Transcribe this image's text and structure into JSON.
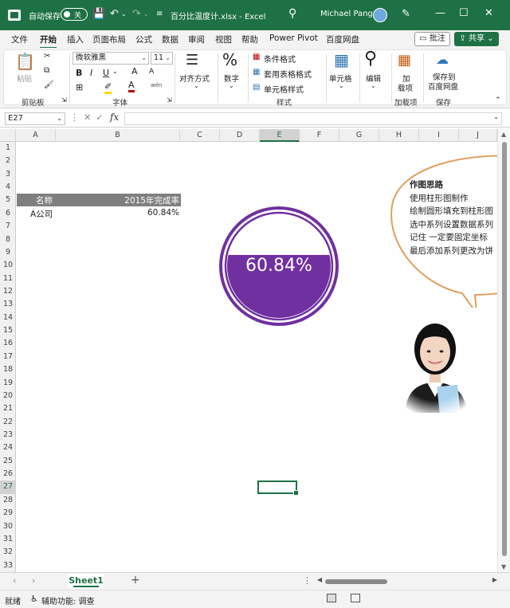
{
  "titlebar": {
    "autosave_label": "自动保存",
    "autosave_state": "关",
    "file_title": "百分比温度计.xlsx - Excel",
    "user_name": "Michael Pang"
  },
  "tabs": [
    "文件",
    "开始",
    "插入",
    "页面布局",
    "公式",
    "数据",
    "审阅",
    "视图",
    "帮助",
    "Power Pivot",
    "百度网盘"
  ],
  "active_tab": "开始",
  "actions": {
    "comment": "批注",
    "share": "共享"
  },
  "ribbon": {
    "clipboard": {
      "paste": "粘贴",
      "label": "剪贴板"
    },
    "font": {
      "name": "微软雅黑",
      "size": "11",
      "label": "字体",
      "bold": "B",
      "italic": "I",
      "underline": "U",
      "grow": "A",
      "shrink": "A",
      "wen": "wén"
    },
    "alignment": {
      "label": "对齐方式"
    },
    "number": {
      "label": "数字",
      "glyph": "%"
    },
    "styles": {
      "conditional": "条件格式",
      "table": "套用表格格式",
      "cell_styles": "单元格样式",
      "label": "样式"
    },
    "cells": {
      "label": "单元格"
    },
    "editing": {
      "label": "编辑"
    },
    "addins": {
      "btn_line1": "加",
      "btn_line2": "载项",
      "label": "加载项"
    },
    "save": {
      "btn_line1": "保存到",
      "btn_line2": "百度网盘",
      "label": "保存"
    }
  },
  "formula_bar": {
    "name_box": "E27",
    "fx": "fx",
    "value": ""
  },
  "columns": [
    "A",
    "B",
    "C",
    "D",
    "E",
    "F",
    "G",
    "H",
    "I",
    "J"
  ],
  "selected_column": "E",
  "rows": [
    "1",
    "2",
    "3",
    "4",
    "5",
    "6",
    "7",
    "8",
    "9",
    "10",
    "11",
    "12",
    "13",
    "14",
    "15",
    "16",
    "17",
    "18",
    "19",
    "20",
    "21",
    "22",
    "23",
    "24",
    "25",
    "26",
    "27",
    "28",
    "29",
    "30",
    "31",
    "32",
    "33"
  ],
  "selected_row": "27",
  "table": {
    "headers": [
      "名称",
      "2015年完成率"
    ],
    "rows": [
      [
        "A公司",
        "60.84%"
      ]
    ]
  },
  "chart_data": {
    "type": "gauge",
    "series": [
      {
        "values": [
          0.6084
        ]
      }
    ],
    "label": "60.84%",
    "colors": {
      "fill": "#7030a0",
      "ring": "#7030a0",
      "background": "#ffffff"
    }
  },
  "callout": {
    "title": "作图思路",
    "lines": [
      "使用柱形图制作",
      "绘制圆形填充到柱形图",
      "选中系列设置数据系列",
      "记住  一定要固定坐标",
      "最后添加系列更改为饼"
    ]
  },
  "sheet_tabs": [
    "Sheet1"
  ],
  "status": {
    "ready": "就绪",
    "accessibility": "辅助功能: 调查"
  },
  "colors": {
    "brand": "#1e7145",
    "header_fill": "#7f7f7f",
    "callout_border": "#e0a060"
  }
}
